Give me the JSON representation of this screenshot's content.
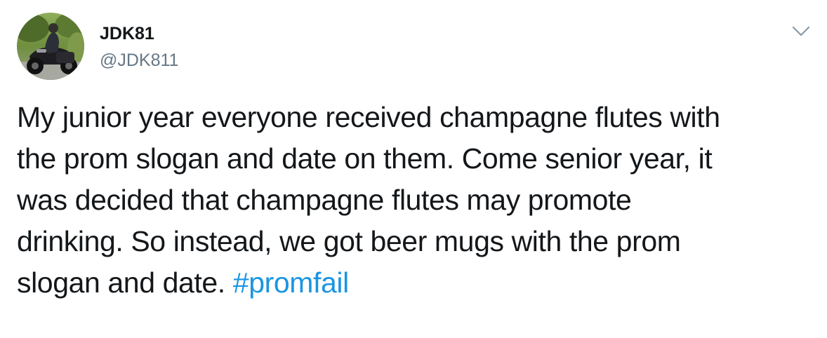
{
  "tweet": {
    "author": {
      "display_name": "JDK81",
      "handle": "@JDK811",
      "avatar_icon": "motorcycle-rider-avatar"
    },
    "menu_icon": "chevron-down-icon",
    "text_lines": [
      "My junior year everyone received champagne flutes with",
      "the prom slogan and date on them. Come senior year, it",
      "was decided that champagne flutes may promote",
      "drinking. So instead, we got beer mugs with the prom",
      "slogan and date. "
    ],
    "hashtag": "#promfail",
    "colors": {
      "text": "#14171a",
      "handle": "#657786",
      "link": "#1b95e0"
    }
  }
}
